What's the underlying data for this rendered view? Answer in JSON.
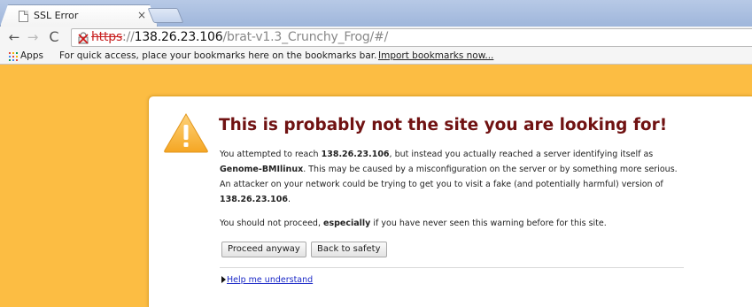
{
  "tab": {
    "title": "SSL Error",
    "close_glyph": "×",
    "favicon": "page-icon"
  },
  "toolbar": {
    "back_glyph": "←",
    "forward_glyph": "→",
    "reload_glyph": "C",
    "url": {
      "scheme": "https",
      "separator": "://",
      "host": "138.26.23.106",
      "path": "/brat-v1.3_Crunchy_Frog/#/"
    },
    "security_icon": "broken-lock-icon"
  },
  "bookmarks_bar": {
    "apps_label": "Apps",
    "hint": "For quick access, place your bookmarks here on the bookmarks bar.",
    "import_link": "Import bookmarks now..."
  },
  "interstitial": {
    "icon": "warning-icon",
    "headline": "This is probably not the site you are looking for!",
    "p1": {
      "t1": "You attempted to reach ",
      "host": "138.26.23.106",
      "t2": ", but instead you actually reached a server identifying itself as ",
      "server": "Genome-BMIlinux",
      "t3": ". This may be caused by a misconfiguration on the server or by something more serious. An attacker on your network could be trying to get you to visit a fake (and potentially harmful) version of ",
      "host2": "138.26.23.106",
      "t4": "."
    },
    "p2": {
      "t1": "You should not proceed, ",
      "emph": "especially",
      "t2": " if you have never seen this warning before for this site."
    },
    "proceed_button": "Proceed anyway",
    "back_button": "Back to safety",
    "help_link": "Help me understand"
  },
  "colors": {
    "page_background": "#fcbd43",
    "headline": "#701212",
    "link": "#1a28c7",
    "insecure_scheme": "#c81f1f"
  }
}
